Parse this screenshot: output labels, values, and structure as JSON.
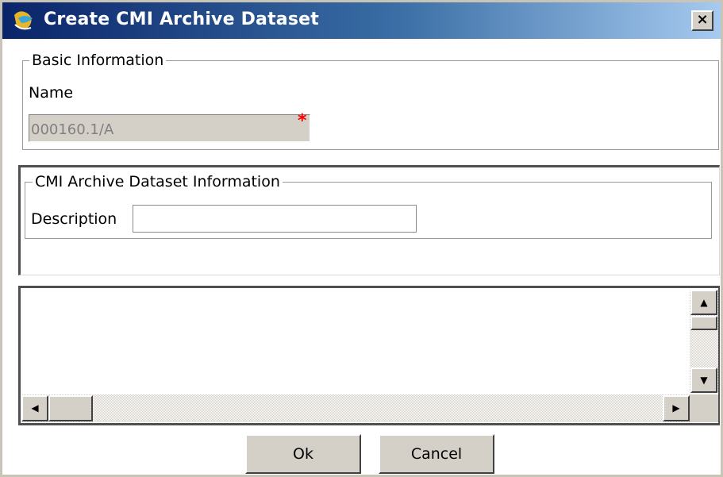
{
  "window": {
    "title": "Create CMI Archive Dataset",
    "close_glyph": "×",
    "icon": "app-logo-icon"
  },
  "basic_info": {
    "legend": "Basic Information",
    "name_label": "Name",
    "name_value": "000160.1/A",
    "required_marker": "*"
  },
  "dataset_info": {
    "legend": "CMI Archive Dataset Information",
    "description_label": "Description",
    "description_value": ""
  },
  "scrollbars": {
    "up_glyph": "▲",
    "down_glyph": "▼",
    "left_glyph": "◀",
    "right_glyph": "▶"
  },
  "buttons": {
    "ok_label": "Ok",
    "cancel_label": "Cancel"
  },
  "colors": {
    "titlebar_start": "#0a246a",
    "titlebar_end": "#a6caf0",
    "required": "#ff0000",
    "face": "#d4d0c8"
  }
}
